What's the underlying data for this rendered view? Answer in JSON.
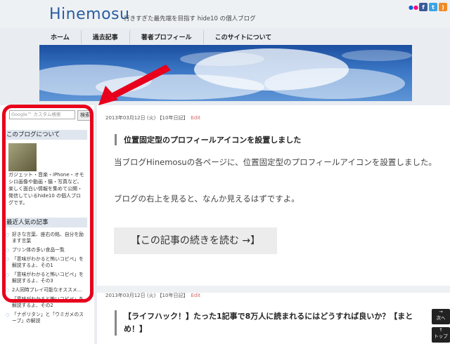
{
  "site": {
    "logo": "Hinemosu",
    "tagline": "行きすぎた最先端を目指す hide10 の個人ブログ"
  },
  "social": [
    {
      "name": "flickr-icon",
      "label": "••",
      "color": "#f5f5f5"
    },
    {
      "name": "facebook-icon",
      "label": "f",
      "color": "#3b5998"
    },
    {
      "name": "twitter-icon",
      "label": "t",
      "color": "#3aa3e3"
    },
    {
      "name": "rss-icon",
      "label": ")",
      "color": "#f08a24"
    }
  ],
  "nav": {
    "items": [
      "ホーム",
      "過去記事",
      "著者プロフィール",
      "このサイトについて"
    ]
  },
  "sidebar": {
    "search_placeholder": "Google™ カスタム検索",
    "search_button": "検索",
    "about_title": "このブログについて",
    "about_text": "ガジェット・音楽・iPhone・オモシロ画像や動画・猫・写真など、楽しく面白い情報を集めて公開・発信しているhide10 の個人ブログです。",
    "popular_title": "最近人気の記事",
    "popular_items": [
      "好きな言葉、座右の銘、自分を励ます言葉",
      "プリン体の多い食品一覧",
      "「意味がわかると怖いコピペ」を解説するよ、その1",
      "「意味がわかると怖いコピペ」を解説するよ、その3",
      "2人同時プレイ可能なオススメ…",
      "「意味がわかると怖いコピペ」を解説するよ、その2",
      "「ナポリタン」と「ウミガメのスープ」の解説"
    ]
  },
  "posts": [
    {
      "meta": "2013年03月12日 (火) 【10年日記】",
      "edit": "Edit",
      "title": "位置固定型のプロフィールアイコンを設置しました",
      "body1": "当ブログHinemosuの各ページに、位置固定型のプロフィールアイコンを設置しました。",
      "body2": "ブログの右上を見ると、なんか見えるはずですよ。",
      "readmore": "【この記事の続きを読む →】"
    },
    {
      "meta": "2013年03月12日 (火) 【10年日記】",
      "edit": "Edit",
      "title": "【ライフハック！】たった1記事で8万人に読まれるにはどうすれば良いか？【まとめ！】"
    }
  ],
  "floating": {
    "next_arrow": "→",
    "next_label": "次へ",
    "top_arrow": "↑",
    "top_label": "トップ"
  }
}
